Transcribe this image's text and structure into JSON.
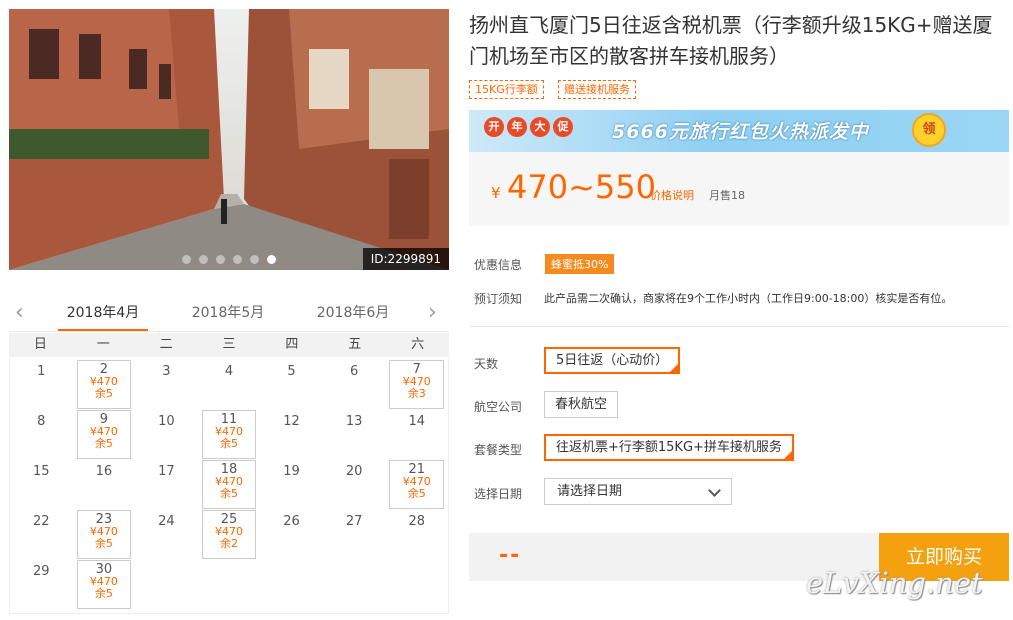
{
  "gallery": {
    "photo_id": "ID:2299891",
    "slide_count": 6,
    "active_slide": 6
  },
  "calendar": {
    "prev_icon": "chevron-left-icon",
    "next_icon": "chevron-right-icon",
    "months": [
      "2018年4月",
      "2018年5月",
      "2018年6月"
    ],
    "active_month": "2018年4月",
    "weekdays": [
      "日",
      "一",
      "二",
      "三",
      "四",
      "五",
      "六"
    ],
    "days": [
      {
        "day": "1"
      },
      {
        "day": "2",
        "price": "¥470",
        "stock": "余5"
      },
      {
        "day": "3"
      },
      {
        "day": "4"
      },
      {
        "day": "5"
      },
      {
        "day": "6"
      },
      {
        "day": "7",
        "price": "¥470",
        "stock": "余3"
      },
      {
        "day": "8"
      },
      {
        "day": "9",
        "price": "¥470",
        "stock": "余5"
      },
      {
        "day": "10"
      },
      {
        "day": "11",
        "price": "¥470",
        "stock": "余5"
      },
      {
        "day": "12"
      },
      {
        "day": "13"
      },
      {
        "day": "14"
      },
      {
        "day": "15"
      },
      {
        "day": "16"
      },
      {
        "day": "17"
      },
      {
        "day": "18",
        "price": "¥470",
        "stock": "余5"
      },
      {
        "day": "19"
      },
      {
        "day": "20"
      },
      {
        "day": "21",
        "price": "¥470",
        "stock": "余5"
      },
      {
        "day": "22"
      },
      {
        "day": "23",
        "price": "¥470",
        "stock": "余5"
      },
      {
        "day": "24"
      },
      {
        "day": "25",
        "price": "¥470",
        "stock": "余2"
      },
      {
        "day": "26"
      },
      {
        "day": "27"
      },
      {
        "day": "28"
      },
      {
        "day": "29"
      },
      {
        "day": "30",
        "price": "¥470",
        "stock": "余5"
      }
    ]
  },
  "product": {
    "title": "扬州直飞厦门5日往返含税机票（行李额升级15KG+赠送厦门机场至市区的散客拼车接机服务）",
    "tags": [
      "15KG行李额",
      "赠送接机服务"
    ],
    "banner": {
      "badge_chars": [
        "开",
        "年",
        "大",
        "促"
      ],
      "text": "5666元旅行红包火热派发中",
      "coupon": "领"
    },
    "currency": "¥",
    "price_range": "470~550",
    "price_note": "价格说明",
    "sold": "月售18"
  },
  "info": {
    "discount_label": "优惠信息",
    "discount_badge": "蜂蜜抵30%",
    "notice_label": "预订须知",
    "notice_text": "此产品需二次确认，商家将在9个工作小时内（工作日9:00-18:00）核实是否有位。"
  },
  "options": {
    "days_label": "天数",
    "days_value": "5日往返（心动价）",
    "airline_label": "航空公司",
    "airline_value": "春秋航空",
    "package_label": "套餐类型",
    "package_value": "往返机票+行李额15KG+拼车接机服务",
    "date_label": "选择日期",
    "date_placeholder": "请选择日期"
  },
  "purchase": {
    "total": "--",
    "buy_label": "立即购买"
  },
  "watermark": "eLvXing.net",
  "colors": {
    "accent": "#ff6600",
    "buy_button": "#f5a00f"
  }
}
